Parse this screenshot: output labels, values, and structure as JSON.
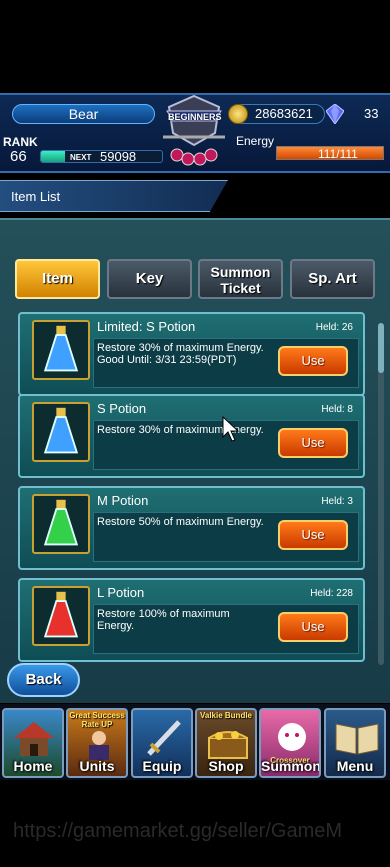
{
  "player": {
    "name": "Bear",
    "rank_label": "RANK",
    "rank": "66",
    "rank_progress": 0.2,
    "next_label": "NEXT",
    "next_exp": "59098"
  },
  "badge": {
    "text": "BEGINNERS"
  },
  "currency": {
    "gil": "28683621",
    "gems": "33"
  },
  "energy": {
    "label": "Energy",
    "value": "111/111",
    "fill": 1.0
  },
  "screen": {
    "title": "Item List"
  },
  "tabs": [
    {
      "label": "Item",
      "active": true
    },
    {
      "label": "Key",
      "active": false
    },
    {
      "label_line1": "Summon",
      "label_line2": "Ticket",
      "active": false
    },
    {
      "label": "Sp. Art",
      "active": false
    }
  ],
  "items": [
    {
      "name": "Limited: S Potion",
      "held": "Held: 26",
      "desc": "Restore 30% of maximum Energy. Good Until: 3/31 23:59(PDT)",
      "use": "Use",
      "color": "#3fa0ff"
    },
    {
      "name": "S Potion",
      "held": "Held: 8",
      "desc": "Restore 30% of maximum Energy.",
      "use": "Use",
      "color": "#3fa0ff"
    },
    {
      "name": "M Potion",
      "held": "Held: 3",
      "desc": "Restore 50% of maximum Energy.",
      "use": "Use",
      "color": "#35d04a"
    },
    {
      "name": "L Potion",
      "held": "Held: 228",
      "desc": "Restore 100% of maximum Energy.",
      "use": "Use",
      "color": "#e8312c"
    }
  ],
  "back_label": "Back",
  "nav": [
    {
      "label": "Home",
      "sub": ""
    },
    {
      "label": "Units",
      "sub": "Great Success Rate UP"
    },
    {
      "label": "Equip",
      "sub": ""
    },
    {
      "label": "Shop",
      "sub": "Valkie Bundle"
    },
    {
      "label": "Summon",
      "sub": "Crossover"
    },
    {
      "label": "Menu",
      "sub": ""
    }
  ],
  "watermark": "https://gamemarket.gg/seller/GameM"
}
